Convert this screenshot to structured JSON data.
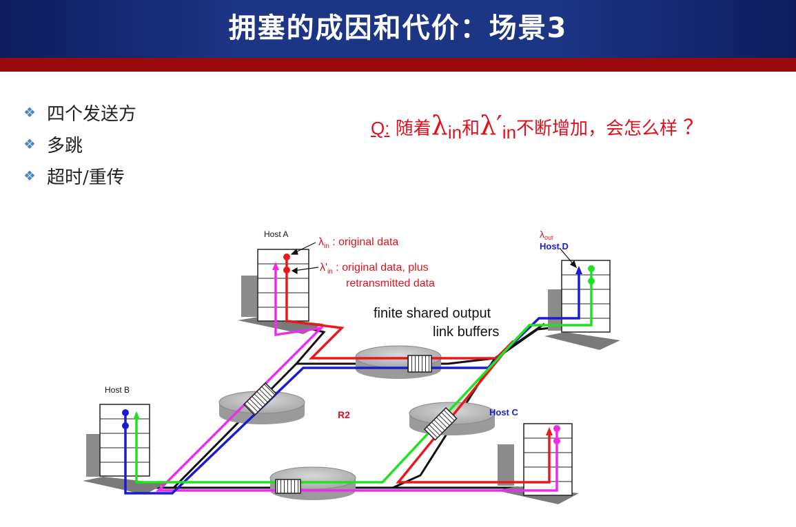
{
  "slide": {
    "title": "拥塞的成因和代价：场景3",
    "bullets": [
      "四个发送方",
      "多跳",
      "超时/重传"
    ],
    "question": {
      "q_label": "Q:",
      "text_before": " 随着",
      "lambda1": "λ",
      "sub1": "in",
      "and_text": "和",
      "lambda2": "λ′",
      "sub2": "in",
      "text_after": "不断增加，会怎么样",
      "qmark": "？"
    }
  },
  "diagram": {
    "host_a": "Host A",
    "host_b": "Host B",
    "host_c": "Host C",
    "host_d": "Host D",
    "router_label": "R2",
    "lambda_in_sym": "λ",
    "lambda_in_sub": "in",
    "lambda_in_text": " : original data",
    "lambda_prime_sym": "λ'",
    "lambda_prime_sub": "in",
    "lambda_prime_text1": " : original data, plus",
    "lambda_prime_text2": "retransmitted data",
    "lambda_out_sym": "λ",
    "lambda_out_sub": "out",
    "buffer_label1": "finite shared output",
    "buffer_label2": "link buffers",
    "colors": {
      "red": "#e8191c",
      "blue": "#1b1bd0",
      "green": "#22e022",
      "magenta": "#ee2cee",
      "label_red": "#e0101e"
    }
  }
}
